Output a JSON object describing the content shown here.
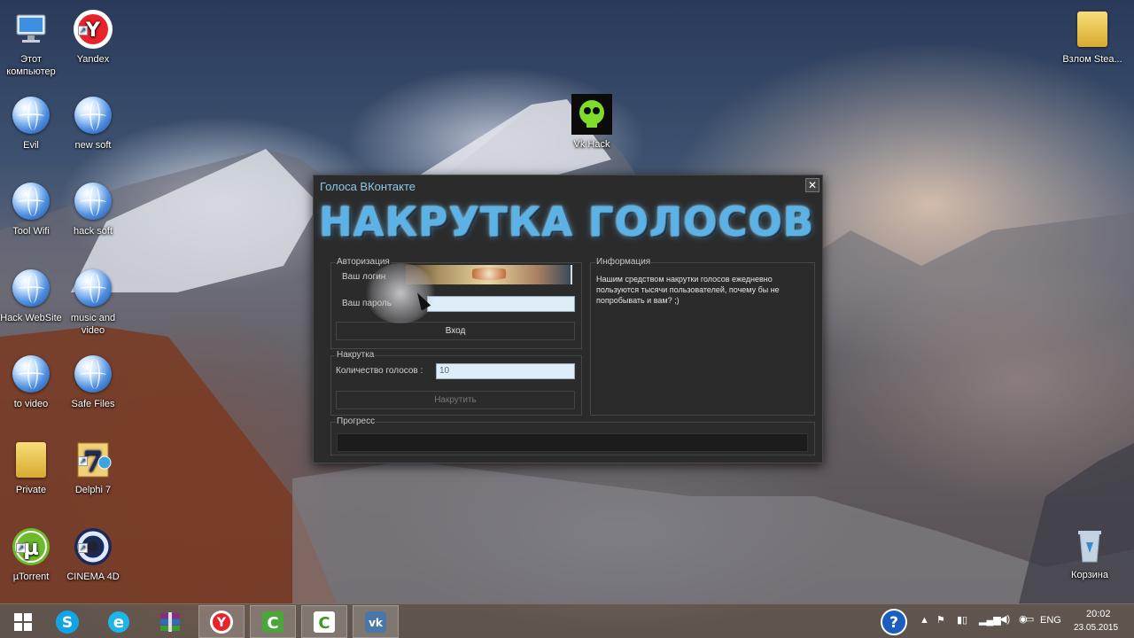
{
  "desktop": {
    "icons": [
      {
        "label": "Этот компьютер"
      },
      {
        "label": "Yandex"
      },
      {
        "label": "Evil"
      },
      {
        "label": "new soft"
      },
      {
        "label": "Tool Wifi"
      },
      {
        "label": "hack soft"
      },
      {
        "label": "Hack WebSite"
      },
      {
        "label": "music and video"
      },
      {
        "label": "to video"
      },
      {
        "label": "Safe Files"
      },
      {
        "label": "Private"
      },
      {
        "label": "Delphi 7"
      },
      {
        "label": "µTorrent"
      },
      {
        "label": "CINEMA 4D"
      },
      {
        "label": "Vk Hack"
      },
      {
        "label": "Взлом Stea..."
      },
      {
        "label": "Корзина"
      }
    ]
  },
  "dialog": {
    "title": "Голоса ВКонтакте",
    "close_glyph": "✕",
    "banner": "НАКРУТКА ГОЛОСОВ",
    "auth": {
      "group_label": "Авторизация",
      "login_label": "Ваш логин",
      "password_label": "Ваш пароль",
      "login_button": "Вход"
    },
    "boost": {
      "group_label": "Накрутка",
      "count_label": "Количество голосов :",
      "count_value": "10",
      "boost_button": "Накрутить"
    },
    "info": {
      "group_label": "Информация",
      "text": "Нашим средством накрутки голосов ежедневно пользуются тысячи пользователей, почему бы не попробывать и вам? ;)"
    },
    "progress": {
      "group_label": "Прогресс",
      "value": 0
    }
  },
  "taskbar": {
    "buttons": [
      {
        "icon": "windows-start-icon"
      },
      {
        "icon": "skype-icon"
      },
      {
        "icon": "internet-explorer-icon"
      },
      {
        "icon": "winrar-icon"
      },
      {
        "icon": "yandex-browser-icon"
      },
      {
        "icon": "camtasia-icon"
      },
      {
        "icon": "camtasia-recorder-icon"
      },
      {
        "icon": "vk-icon"
      }
    ],
    "tray": {
      "language": "ENG",
      "time": "20:02",
      "date": "23.05.2015"
    }
  },
  "colors": {
    "banner": "#5ab2e6",
    "dialog_bg": "#2b2b2b",
    "title_text": "#8fc8ea"
  }
}
